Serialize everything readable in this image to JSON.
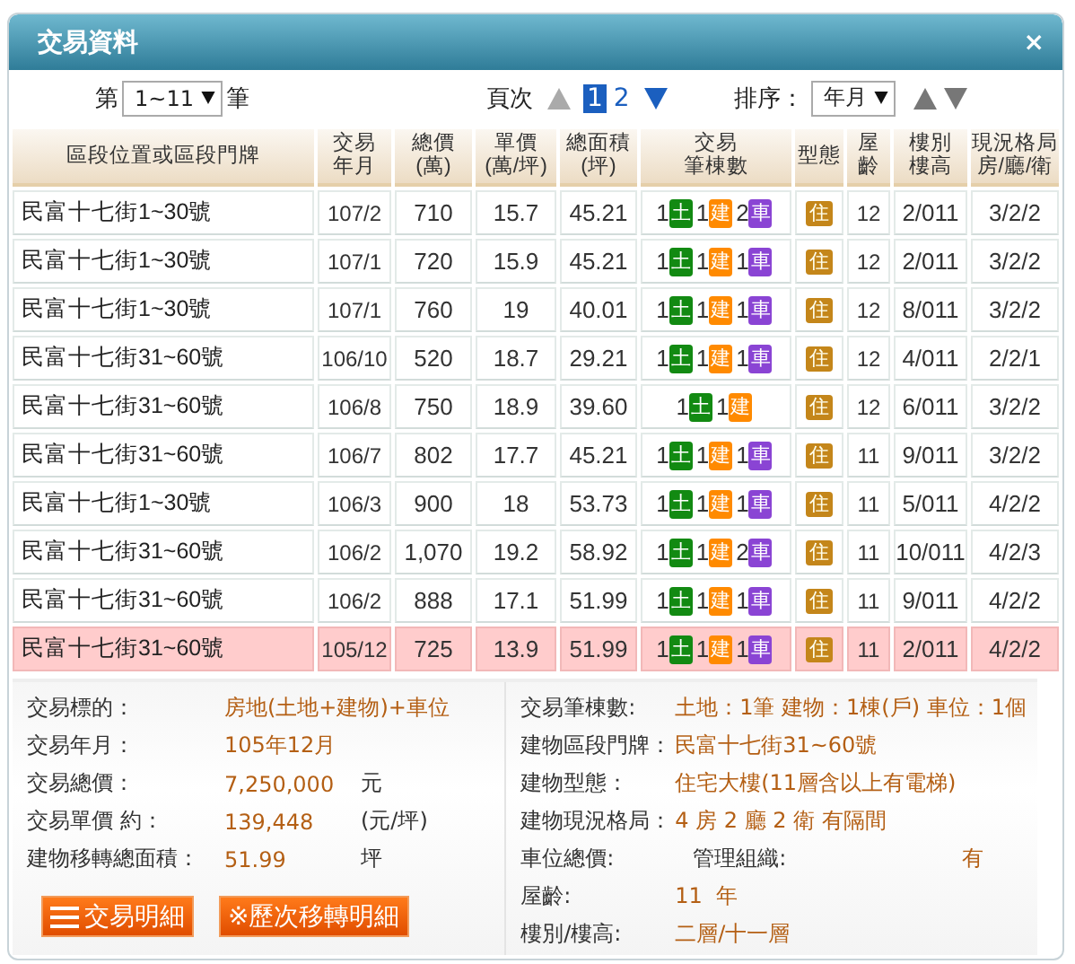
{
  "window": {
    "title": "交易資料",
    "close": "×"
  },
  "range": {
    "prefix": "第",
    "value": "1~11",
    "suffix": "筆"
  },
  "pager": {
    "label": "頁次",
    "pages": [
      {
        "label": "1",
        "selected": true
      },
      {
        "label": "2",
        "selected": false
      }
    ]
  },
  "sort": {
    "label": "排序：",
    "value": "年月"
  },
  "table": {
    "columns": [
      {
        "lines": [
          "區段位置或區段門牌"
        ]
      },
      {
        "lines": [
          "交易",
          "年月"
        ]
      },
      {
        "lines": [
          "總價",
          "(萬)"
        ]
      },
      {
        "lines": [
          "單價",
          "(萬/坪)"
        ]
      },
      {
        "lines": [
          "總面積",
          "(坪)"
        ]
      },
      {
        "lines": [
          "交易",
          "筆棟數"
        ]
      },
      {
        "lines": [
          "型態"
        ]
      },
      {
        "lines": [
          "屋",
          "齡"
        ]
      },
      {
        "lines": [
          "樓別",
          "樓高"
        ]
      },
      {
        "lines": [
          "現況格局",
          "房/廳/衛"
        ]
      }
    ],
    "rows": [
      {
        "location": "民富十七街1~30號",
        "date": "107/2",
        "total": "710",
        "unit": "15.7",
        "area": "45.21",
        "counts": [
          {
            "kind": "land",
            "count": "1",
            "label": "土"
          },
          {
            "kind": "building",
            "count": "1",
            "label": "建"
          },
          {
            "kind": "car",
            "count": "2",
            "label": "車"
          }
        ],
        "type": "住",
        "age": "12",
        "floor": "2/011",
        "layout": "3/2/2",
        "selected": false
      },
      {
        "location": "民富十七街1~30號",
        "date": "107/1",
        "total": "720",
        "unit": "15.9",
        "area": "45.21",
        "counts": [
          {
            "kind": "land",
            "count": "1",
            "label": "土"
          },
          {
            "kind": "building",
            "count": "1",
            "label": "建"
          },
          {
            "kind": "car",
            "count": "1",
            "label": "車"
          }
        ],
        "type": "住",
        "age": "12",
        "floor": "2/011",
        "layout": "3/2/2",
        "selected": false
      },
      {
        "location": "民富十七街1~30號",
        "date": "107/1",
        "total": "760",
        "unit": "19",
        "area": "40.01",
        "counts": [
          {
            "kind": "land",
            "count": "1",
            "label": "土"
          },
          {
            "kind": "building",
            "count": "1",
            "label": "建"
          },
          {
            "kind": "car",
            "count": "1",
            "label": "車"
          }
        ],
        "type": "住",
        "age": "12",
        "floor": "8/011",
        "layout": "3/2/2",
        "selected": false
      },
      {
        "location": "民富十七街31~60號",
        "date": "106/10",
        "total": "520",
        "unit": "18.7",
        "area": "29.21",
        "counts": [
          {
            "kind": "land",
            "count": "1",
            "label": "土"
          },
          {
            "kind": "building",
            "count": "1",
            "label": "建"
          },
          {
            "kind": "car",
            "count": "1",
            "label": "車"
          }
        ],
        "type": "住",
        "age": "12",
        "floor": "4/011",
        "layout": "2/2/1",
        "selected": false
      },
      {
        "location": "民富十七街31~60號",
        "date": "106/8",
        "total": "750",
        "unit": "18.9",
        "area": "39.60",
        "counts": [
          {
            "kind": "land",
            "count": "1",
            "label": "土"
          },
          {
            "kind": "building",
            "count": "1",
            "label": "建"
          }
        ],
        "type": "住",
        "age": "12",
        "floor": "6/011",
        "layout": "3/2/2",
        "selected": false
      },
      {
        "location": "民富十七街31~60號",
        "date": "106/7",
        "total": "802",
        "unit": "17.7",
        "area": "45.21",
        "counts": [
          {
            "kind": "land",
            "count": "1",
            "label": "土"
          },
          {
            "kind": "building",
            "count": "1",
            "label": "建"
          },
          {
            "kind": "car",
            "count": "1",
            "label": "車"
          }
        ],
        "type": "住",
        "age": "11",
        "floor": "9/011",
        "layout": "3/2/2",
        "selected": false
      },
      {
        "location": "民富十七街1~30號",
        "date": "106/3",
        "total": "900",
        "unit": "18",
        "area": "53.73",
        "counts": [
          {
            "kind": "land",
            "count": "1",
            "label": "土"
          },
          {
            "kind": "building",
            "count": "1",
            "label": "建"
          },
          {
            "kind": "car",
            "count": "1",
            "label": "車"
          }
        ],
        "type": "住",
        "age": "11",
        "floor": "5/011",
        "layout": "4/2/2",
        "selected": false
      },
      {
        "location": "民富十七街31~60號",
        "date": "106/2",
        "total": "1,070",
        "unit": "19.2",
        "area": "58.92",
        "counts": [
          {
            "kind": "land",
            "count": "1",
            "label": "土"
          },
          {
            "kind": "building",
            "count": "1",
            "label": "建"
          },
          {
            "kind": "car",
            "count": "2",
            "label": "車"
          }
        ],
        "type": "住",
        "age": "11",
        "floor": "10/011",
        "layout": "4/2/3",
        "selected": false
      },
      {
        "location": "民富十七街31~60號",
        "date": "106/2",
        "total": "888",
        "unit": "17.1",
        "area": "51.99",
        "counts": [
          {
            "kind": "land",
            "count": "1",
            "label": "土"
          },
          {
            "kind": "building",
            "count": "1",
            "label": "建"
          },
          {
            "kind": "car",
            "count": "1",
            "label": "車"
          }
        ],
        "type": "住",
        "age": "11",
        "floor": "9/011",
        "layout": "4/2/2",
        "selected": false
      },
      {
        "location": "民富十七街31~60號",
        "date": "105/12",
        "total": "725",
        "unit": "13.9",
        "area": "51.99",
        "counts": [
          {
            "kind": "land",
            "count": "1",
            "label": "土"
          },
          {
            "kind": "building",
            "count": "1",
            "label": "建"
          },
          {
            "kind": "car",
            "count": "1",
            "label": "車"
          }
        ],
        "type": "住",
        "age": "11",
        "floor": "2/011",
        "layout": "4/2/2",
        "selected": true
      }
    ]
  },
  "detail": {
    "left": [
      {
        "label": "交易標的：",
        "value": "房地(土地+建物)+車位"
      },
      {
        "label": "交易年月：",
        "value": "105年12月"
      },
      {
        "label": "交易總價：",
        "value": "7,250,000",
        "unit": "元"
      },
      {
        "label": "交易單價 約：",
        "value": "139,448",
        "unit": "(元/坪)"
      },
      {
        "label": "建物移轉總面積：",
        "value": "51.99",
        "unit": "坪"
      }
    ],
    "buttons": [
      {
        "kind": "list",
        "label": "交易明細"
      },
      {
        "kind": "plain",
        "label": "※歷次移轉明細"
      }
    ],
    "right": [
      {
        "kind": "pair",
        "label": "交易筆棟數:",
        "value": "土地：1筆 建物：1棟(戶) 車位：1個"
      },
      {
        "kind": "pair",
        "label": "建物區段門牌：",
        "value": "民富十七街31~60號"
      },
      {
        "kind": "pair",
        "label": "建物型態：",
        "value": "住宅大樓(11層含以上有電梯)"
      },
      {
        "kind": "pair",
        "label": "建物現況格局：",
        "value": "4 房 2 廳 2 衛 有隔間"
      },
      {
        "kind": "split",
        "label": "車位總價:",
        "label2": "管理組織:",
        "value2": "有"
      },
      {
        "kind": "pair",
        "label": "屋齡:",
        "value": "11  年"
      },
      {
        "kind": "pair",
        "label": "樓別/樓高:",
        "value": "二層/十一層"
      }
    ]
  }
}
